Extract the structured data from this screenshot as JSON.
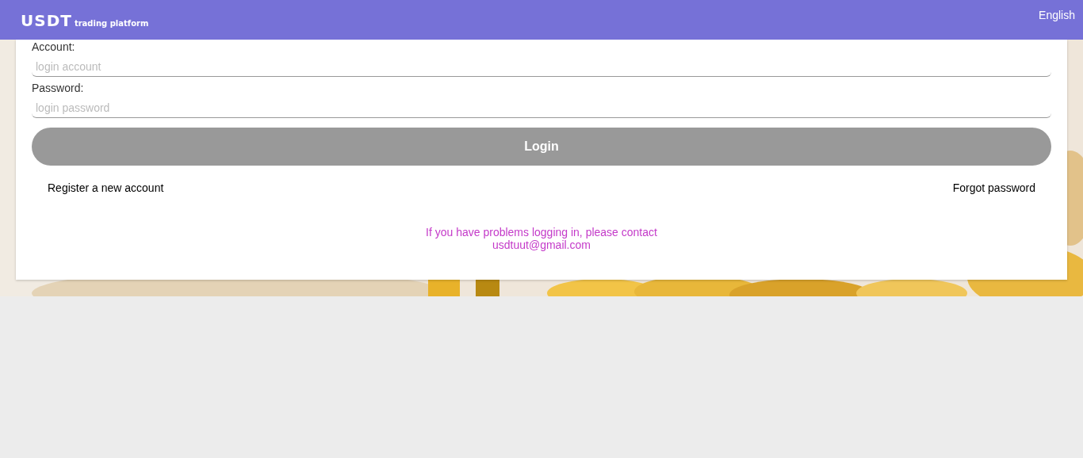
{
  "header": {
    "logo": "USDT",
    "tagline": "trading platform",
    "language": "English"
  },
  "form": {
    "fields": [
      {
        "label": "Account:",
        "placeholder": "login account"
      },
      {
        "label": "Password:",
        "placeholder": "login password"
      }
    ],
    "login_button": "Login",
    "links": [
      "Register a new account",
      "Forgot password"
    ],
    "contact": [
      "If you have problems logging in, please contact",
      "usdtuut@gmail.com"
    ]
  }
}
